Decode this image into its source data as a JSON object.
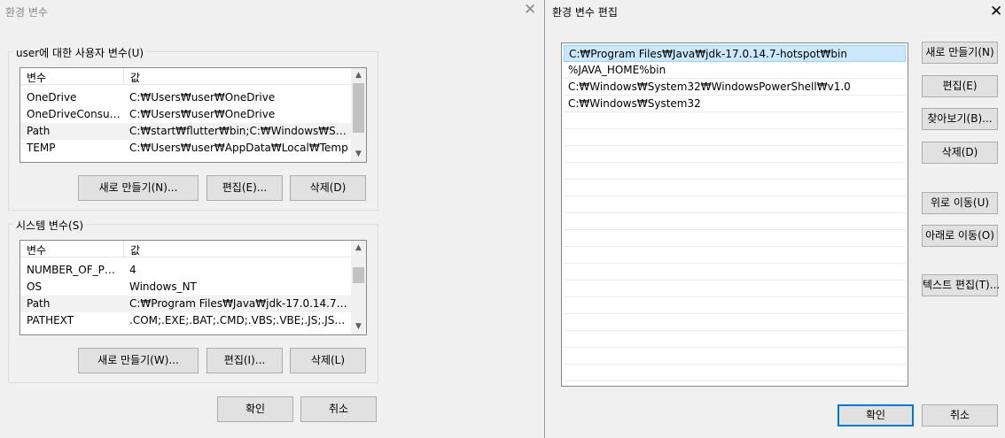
{
  "env_dialog": {
    "title": "환경 변수",
    "user_group_label": "user에 대한 사용자 변수(U)",
    "columns": {
      "variable": "변수",
      "value": "값"
    },
    "user_vars": [
      {
        "name": "OneDrive",
        "value": "C:₩Users₩user₩OneDrive"
      },
      {
        "name": "OneDriveConsumer",
        "value": "C:₩Users₩user₩OneDrive"
      },
      {
        "name": "Path",
        "value": "C:₩start₩flutter₩bin;C:₩Windows₩System..."
      },
      {
        "name": "TEMP",
        "value": "C:₩Users₩user₩AppData₩Local₩Temp"
      }
    ],
    "user_buttons": {
      "new": "새로 만들기(N)...",
      "edit": "편집(E)...",
      "delete": "삭제(D)"
    },
    "system_group_label": "시스템 변수(S)",
    "system_vars": [
      {
        "name": "NUMBER_OF_PRO...",
        "value": "4"
      },
      {
        "name": "OS",
        "value": "Windows_NT"
      },
      {
        "name": "Path",
        "value": "C:₩Program Files₩Java₩jdk-17.0.14.7-hots..."
      },
      {
        "name": "PATHEXT",
        "value": ".COM;.EXE;.BAT;.CMD;.VBS;.VBE;.JS;.JSE;.W..."
      }
    ],
    "system_buttons": {
      "new": "새로 만들기(W)...",
      "edit": "편집(I)...",
      "delete": "삭제(L)"
    },
    "ok": "확인",
    "cancel": "취소"
  },
  "edit_dialog": {
    "title": "환경 변수 편집",
    "paths": [
      "C:₩Program Files₩Java₩jdk-17.0.14.7-hotspot₩bin",
      "%JAVA_HOME%bin",
      "C:₩Windows₩System32₩WindowsPowerShell₩v1.0",
      "C:₩Windows₩System32"
    ],
    "selected_index": 0,
    "buttons": {
      "new": "새로 만들기(N)",
      "edit": "편집(E)",
      "browse": "찾아보기(B)...",
      "delete": "삭제(D)",
      "move_up": "위로 이동(U)",
      "move_down": "아래로 이동(O)",
      "edit_text": "텍스트 편집(T)..."
    },
    "ok": "확인",
    "cancel": "취소"
  },
  "icons": {
    "close": "close-icon",
    "scroll_up": "scroll-up-icon",
    "scroll_down": "scroll-down-icon"
  },
  "colors": {
    "selection": "#cce8ff",
    "default_button_border": "#0078d7",
    "button_face": "#e1e1e1"
  }
}
